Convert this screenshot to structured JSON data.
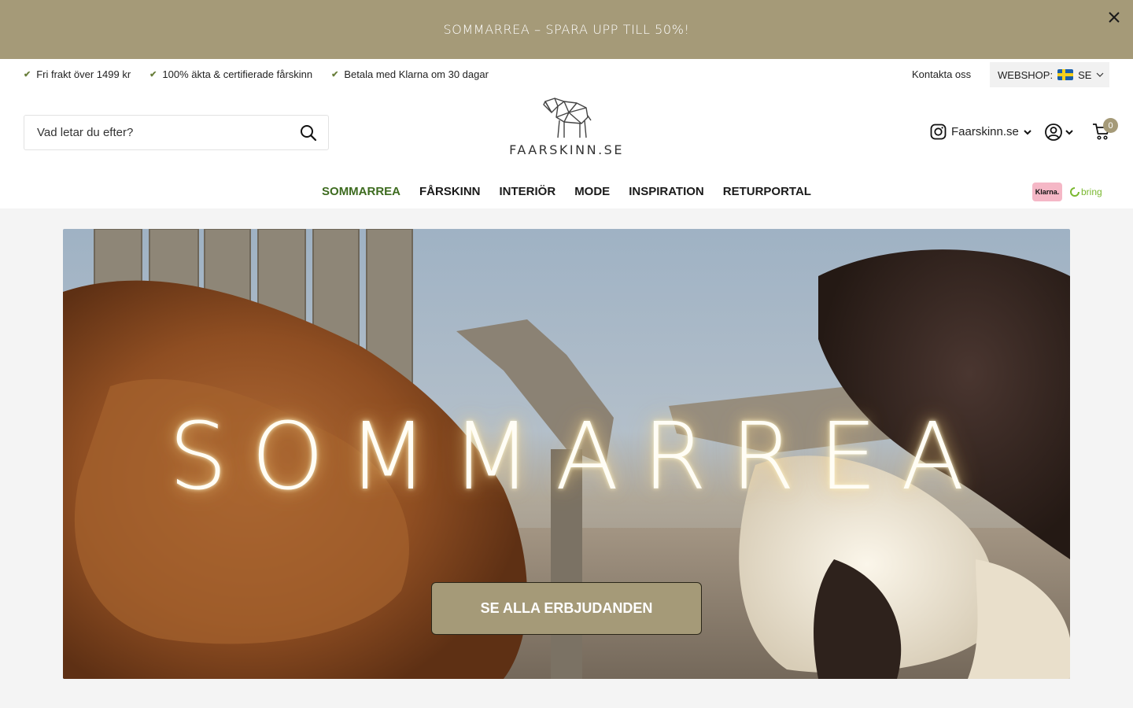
{
  "promo": {
    "text": "SOMMARREA – SPARA UPP TILL 50%!",
    "close_icon": "close-icon"
  },
  "usps": [
    {
      "text": "Fri frakt över 1499 kr"
    },
    {
      "text": "100% äkta & certifierade fårskinn"
    },
    {
      "text": "Betala med Klarna om 30 dagar"
    }
  ],
  "top_links": {
    "contact": "Kontakta oss",
    "webshop_label": "WEBSHOP:",
    "webshop_country": "SE"
  },
  "search": {
    "placeholder": "Vad letar du efter?"
  },
  "logo": {
    "text": "FAARSKINN.SE"
  },
  "instagram": {
    "label": "Faarskinn.se"
  },
  "cart": {
    "count": "0"
  },
  "nav": [
    "SOMMARREA",
    "FÅRSKINN",
    "INTERIÖR",
    "MODE",
    "INSPIRATION",
    "RETURPORTAL"
  ],
  "payment": {
    "klarna": "Klarna.",
    "bring": "bring"
  },
  "hero": {
    "title": "SOMMARREA",
    "button": "SE ALLA ERBJUDANDEN"
  },
  "colors": {
    "brand": "#a59a78",
    "sale_nav": "#3d6b1f",
    "klarna_pink": "#f5b7c6",
    "bring_green": "#7ab830"
  }
}
